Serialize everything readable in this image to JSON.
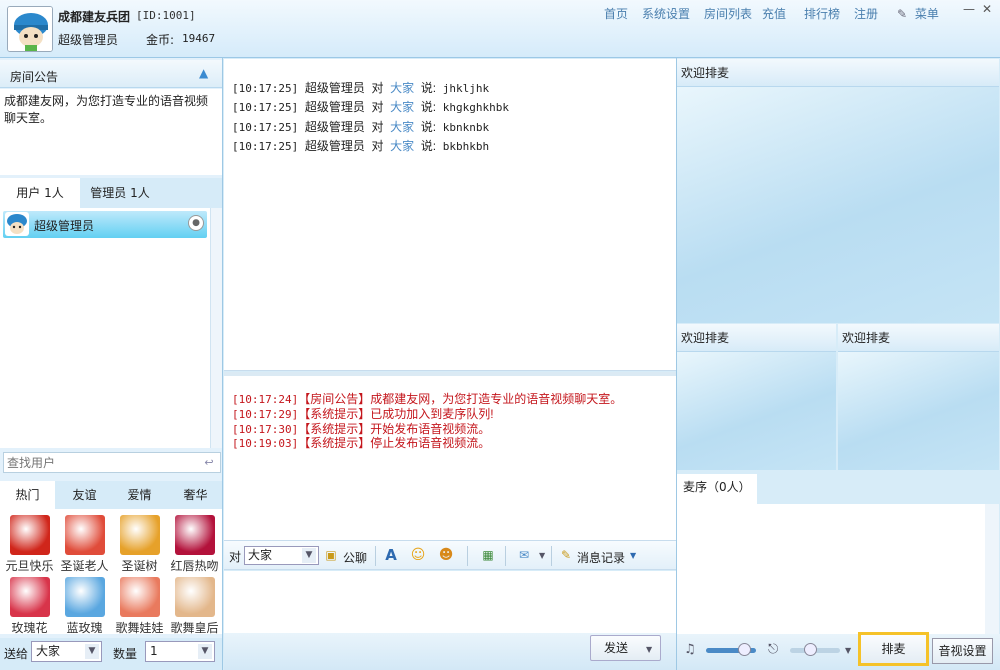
{
  "header": {
    "room_name": "成都建友兵团",
    "room_id": "[ID:1001]",
    "user_role": "超级管理员",
    "coins_label": "金币:",
    "coins_value": "19467",
    "nav": [
      "首页",
      "系统设置",
      "房间列表",
      "充值",
      "排行榜",
      "注册"
    ],
    "menu_label": "菜单",
    "minimize": "—",
    "close": "✕"
  },
  "notice": {
    "title": "房间公告",
    "body": "成都建友网，为您打造专业的语音视频聊天室。"
  },
  "user_tabs": {
    "users": "用户 1人",
    "admins": "管理员 1人"
  },
  "user_list": [
    {
      "name": "超级管理员"
    }
  ],
  "search": {
    "placeholder": "查找用户"
  },
  "gift_tabs": [
    "热门",
    "友谊",
    "爱情",
    "奢华"
  ],
  "gifts": [
    {
      "label": "元旦快乐",
      "color": "#d0261b"
    },
    {
      "label": "圣诞老人",
      "color": "#e04c3a"
    },
    {
      "label": "圣诞树",
      "color": "#e6a12a"
    },
    {
      "label": "红唇热吻",
      "color": "#b3123b"
    },
    {
      "label": "玫瑰花",
      "color": "#d8344a"
    },
    {
      "label": "蓝玫瑰",
      "color": "#5aa7e0"
    },
    {
      "label": "歌舞娃娃",
      "color": "#e97a5e"
    },
    {
      "label": "歌舞皇后",
      "color": "#e3b78b"
    }
  ],
  "send_gift": {
    "to_label": "送给",
    "to_value": "大家",
    "qty_label": "数量",
    "qty_value": "1"
  },
  "public_chat": [
    {
      "time": "[10:17:25]",
      "from": "超级管理员",
      "verb": "对",
      "to": "大家",
      "said": "说:",
      "text": "jhkljhk"
    },
    {
      "time": "[10:17:25]",
      "from": "超级管理员",
      "verb": "对",
      "to": "大家",
      "said": "说:",
      "text": "khgkghkhbk"
    },
    {
      "time": "[10:17:25]",
      "from": "超级管理员",
      "verb": "对",
      "to": "大家",
      "said": "说:",
      "text": "kbnknbk"
    },
    {
      "time": "[10:17:25]",
      "from": "超级管理员",
      "verb": "对",
      "to": "大家",
      "said": "说:",
      "text": "bkbhkbh"
    }
  ],
  "system_chat": [
    {
      "time": "[10:17:24]",
      "tag": "【房间公告】",
      "text": "成都建友网，为您打造专业的语音视频聊天室。"
    },
    {
      "time": "[10:17:29]",
      "tag": "【系统提示】",
      "text": "已成功加入到麦序队列!"
    },
    {
      "time": "[10:17:30]",
      "tag": "【系统提示】",
      "text": "开始发布语音视频流。"
    },
    {
      "time": "[10:19:03]",
      "tag": "【系统提示】",
      "text": "停止发布语音视频流。"
    }
  ],
  "toolbar": {
    "to_label": "对",
    "to_value": "大家",
    "public_label": "公聊",
    "history_label": "消息记录"
  },
  "send_button": "发送",
  "video": {
    "main_title": "欢迎排麦",
    "sub1_title": "欢迎排麦",
    "sub2_title": "欢迎排麦"
  },
  "queue": {
    "tab_label": "麦序（0人）"
  },
  "controls": {
    "queue_button": "排麦",
    "av_settings_button": "音视设置",
    "volume_level": 0.75,
    "mic_level": 0.4
  },
  "colors": {
    "accent": "#4a8ac6",
    "system_text": "#c4161c",
    "highlight_border": "#f5c229"
  }
}
